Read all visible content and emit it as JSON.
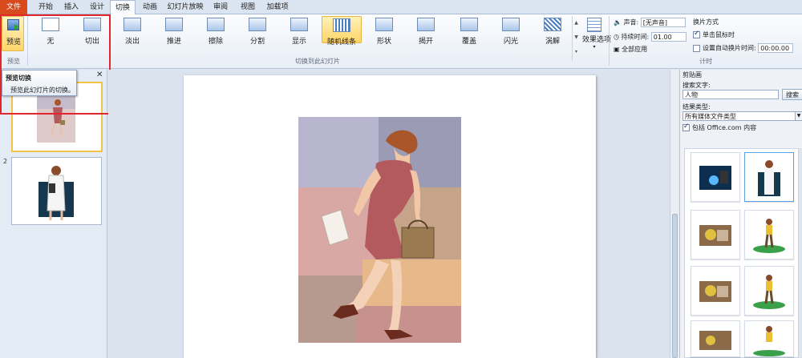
{
  "tabs": [
    "文件",
    "开始",
    "插入",
    "设计",
    "切换",
    "动画",
    "幻灯片放映",
    "审阅",
    "视图",
    "加载项"
  ],
  "ribbon": {
    "preview_label": "预览",
    "preview_group": "预览",
    "transitions": [
      "无",
      "切出",
      "淡出",
      "推进",
      "擦除",
      "分割",
      "显示",
      "随机线条",
      "形状",
      "揭开",
      "覆盖",
      "闪光",
      "涡解"
    ],
    "selected_transition": "随机线条",
    "transition_group": "切换到此幻灯片",
    "effect_options": "效果选项",
    "sound_label": "声音:",
    "sound_value": "[无声音]",
    "duration_label": "持续时间:",
    "duration_value": "01.00",
    "apply_all": "全部应用",
    "advance_title": "换片方式",
    "on_click": "单击鼠标时",
    "auto_after": "设置自动换片时间:",
    "auto_value": "00:00.00",
    "timing_group": "计时"
  },
  "tooltip": {
    "title": "预览切换",
    "text": "预览此幻灯片的切换。"
  },
  "slides": [
    "1",
    "2"
  ],
  "clip_pane": {
    "title": "剪贴画",
    "search_label": "搜索文字:",
    "search_value": "人物",
    "search_button": "搜索",
    "result_type_label": "结果类型:",
    "result_type_value": "所有媒体文件类型",
    "include_office": "包括 Office.com 内容"
  },
  "colors": {
    "file_tab": "#d84a1b",
    "selection": "#ffd466",
    "highlight_box": "#e3262e"
  }
}
